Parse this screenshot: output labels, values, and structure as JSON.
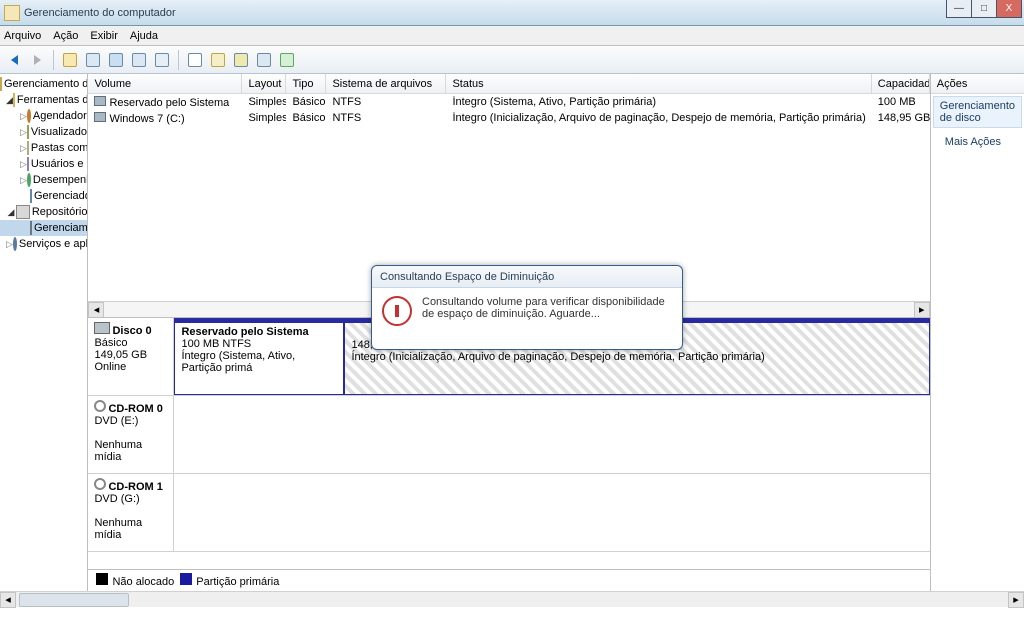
{
  "window": {
    "title": "Gerenciamento do computador"
  },
  "menu": [
    "Arquivo",
    "Ação",
    "Exibir",
    "Ajuda"
  ],
  "tree": {
    "root": "Gerenciamento do computado",
    "tools": "Ferramentas do sistema",
    "scheduler": "Agendador de Tarefas",
    "events": "Visualizador de Eventos",
    "shared": "Pastas compartilhadas",
    "users": "Usuários e Grupos Loca",
    "perf": "Desempenho",
    "devmgr": "Gerenciador de Disposit",
    "storage": "Repositório",
    "diskmgmt": "Gerenciamento de disco",
    "services": "Serviços e aplicativos"
  },
  "columns": {
    "volume": "Volume",
    "layout": "Layout",
    "tipo": "Tipo",
    "fs": "Sistema de arquivos",
    "status": "Status",
    "cap": "Capacidad"
  },
  "volumes": [
    {
      "name": "Reservado pelo Sistema",
      "layout": "Simples",
      "tipo": "Básico",
      "fs": "NTFS",
      "status": "Íntegro (Sistema, Ativo, Partição primária)",
      "cap": "100 MB"
    },
    {
      "name": "Windows 7 (C:)",
      "layout": "Simples",
      "tipo": "Básico",
      "fs": "NTFS",
      "status": "Íntegro (Inicialização, Arquivo de paginação, Despejo de memória, Partição primária)",
      "cap": "148,95 GB"
    }
  ],
  "disks": {
    "d0": {
      "title": "Disco 0",
      "type": "Básico",
      "size": "149,05 GB",
      "state": "Online",
      "p1_name": "Reservado pelo Sistema",
      "p1_size": "100 MB NTFS",
      "p1_stat": "Íntegro (Sistema, Ativo, Partição primá",
      "p2_size": "148,95 GB NTFS",
      "p2_stat": "Íntegro (Inicialização, Arquivo de paginação, Despejo de memória, Partição primária)"
    },
    "d1": {
      "title": "CD-ROM 0",
      "type": "DVD (E:)",
      "state": "Nenhuma mídia"
    },
    "d2": {
      "title": "CD-ROM 1",
      "type": "DVD (G:)",
      "state": "Nenhuma mídia"
    }
  },
  "legend": {
    "unalloc": "Não alocado",
    "primary": "Partição primária"
  },
  "actions": {
    "header": "Ações",
    "sub": "Gerenciamento de disco",
    "more": "Mais Ações"
  },
  "dialog": {
    "title": "Consultando Espaço de Diminuição",
    "text": "Consultando volume para verificar disponibilidade de espaço de diminuição. Aguarde..."
  }
}
